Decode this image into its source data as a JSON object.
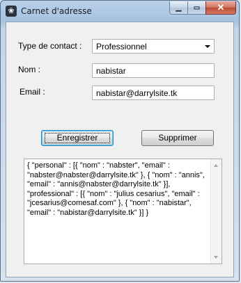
{
  "window": {
    "title": "Carnet d'adresse",
    "icon": "paw-icon",
    "controls": {
      "minimize": "minimize-icon",
      "maximize": "maximize-icon",
      "close": "close-icon"
    }
  },
  "form": {
    "contact_type_label": "Type de contact :",
    "contact_type_value": "Professionnel",
    "name_label": "Nom :",
    "name_value": "nabistar",
    "email_label": "Email :",
    "email_value": "nabistar@darrylsite.tk"
  },
  "buttons": {
    "save_label": "Enregistrer",
    "delete_label": "Supprimer"
  },
  "output": {
    "json_text": "{ \"personal\" : [{ \"nom\" : \"nabster\", \"email\" : \"nabster@nabster@darrylsite.tk\" }, { \"nom\" : \"annis\", \"email\" : \"annis@nabster@darrylsite.tk\" }], \"professional\" : [{ \"nom\" : \"julius cesarius\", \"email\" : \"jcesarius@comesaf.com\" }, { \"nom\" : \"nabistar\", \"email\" : \"nabistar@darrylsite.tk\" }] }"
  }
}
